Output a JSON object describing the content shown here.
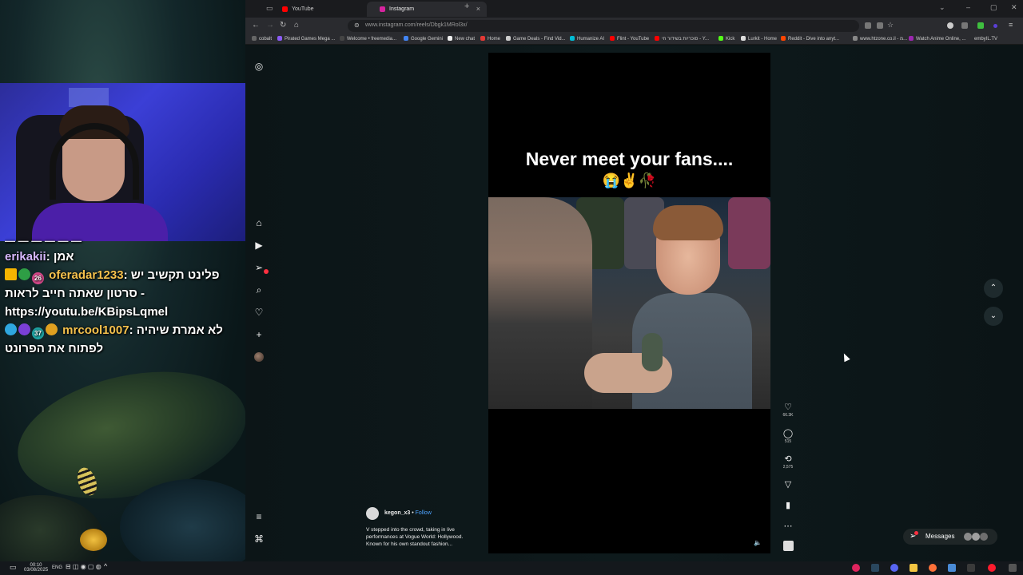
{
  "chat": {
    "messages": [
      {
        "user": "erikakii",
        "text": "אמן"
      },
      {
        "user": "oferadar1233",
        "badge_num": "26",
        "text": "פלינט תקשיב יש סרטון שאתה חייב לראות - https://youtu.be/KBipsLqmel"
      },
      {
        "user": "mrcool1007",
        "badge_num": "37",
        "text": "לא אמרת שיהיה לפתוח את הפרונט"
      }
    ]
  },
  "browser": {
    "tabs": [
      {
        "label": "YouTube",
        "color": "#ff0000"
      },
      {
        "label": "Instagram",
        "color": "#d6249f",
        "active": true
      }
    ],
    "url": "www.instagram.com/reels/Dbgk1MRol3x/",
    "bookmarks": [
      {
        "label": "cobalt",
        "color": "#666666"
      },
      {
        "label": "Pirated Games Mega ...",
        "color": "#8b5cf6"
      },
      {
        "label": "Welcome • freemedia...",
        "color": "#444444"
      },
      {
        "label": "Google Gemini",
        "color": "#4285f4"
      },
      {
        "label": "New chat",
        "color": "#eeeeee"
      },
      {
        "label": "Home",
        "color": "#e53935"
      },
      {
        "label": "Game Deals - Find Vid...",
        "color": "#cccccc"
      },
      {
        "label": "Humanize AI",
        "color": "#00bcd4"
      },
      {
        "label": "Flint - YouTube",
        "color": "#ff0000"
      },
      {
        "label": "סוכריות בשידור חי - Y...",
        "color": "#ff0000"
      },
      {
        "label": "Kick",
        "color": "#53fc18"
      },
      {
        "label": "Lurkit - Home",
        "color": "#dddddd"
      },
      {
        "label": "Reddit - Dive into anyt...",
        "color": "#ff4500"
      },
      {
        "label": "www.htzone.co.il - מ...",
        "color": "#888888"
      },
      {
        "label": "Watch Anime Online, ...",
        "color": "#9c27b0"
      },
      {
        "label": "embyIL.TV",
        "color": "#4caf50"
      }
    ]
  },
  "reel": {
    "title": "Never meet your fans....",
    "emoji": "😭✌️🥀",
    "author": "kegon_x3",
    "dot": "•",
    "follow": "Follow",
    "caption": "V stepped into the crowd, taking in live performances at Vogue World: Hollywood. Known for his own standout fashion...",
    "likes": "66.3K",
    "comments": "515",
    "reposts": "2,575"
  },
  "messages_label": "Messages",
  "taskbar": {
    "time": "00:10",
    "date": "03/08/2025",
    "lang": "ENG"
  },
  "icons": {
    "instagram": "instagram-icon",
    "home": "home-icon",
    "reels": "reels-icon",
    "send": "send-icon",
    "search": "search-icon",
    "heart": "heart-icon",
    "plus": "plus-icon",
    "menu": "menu-icon",
    "threads": "meta-icon"
  }
}
